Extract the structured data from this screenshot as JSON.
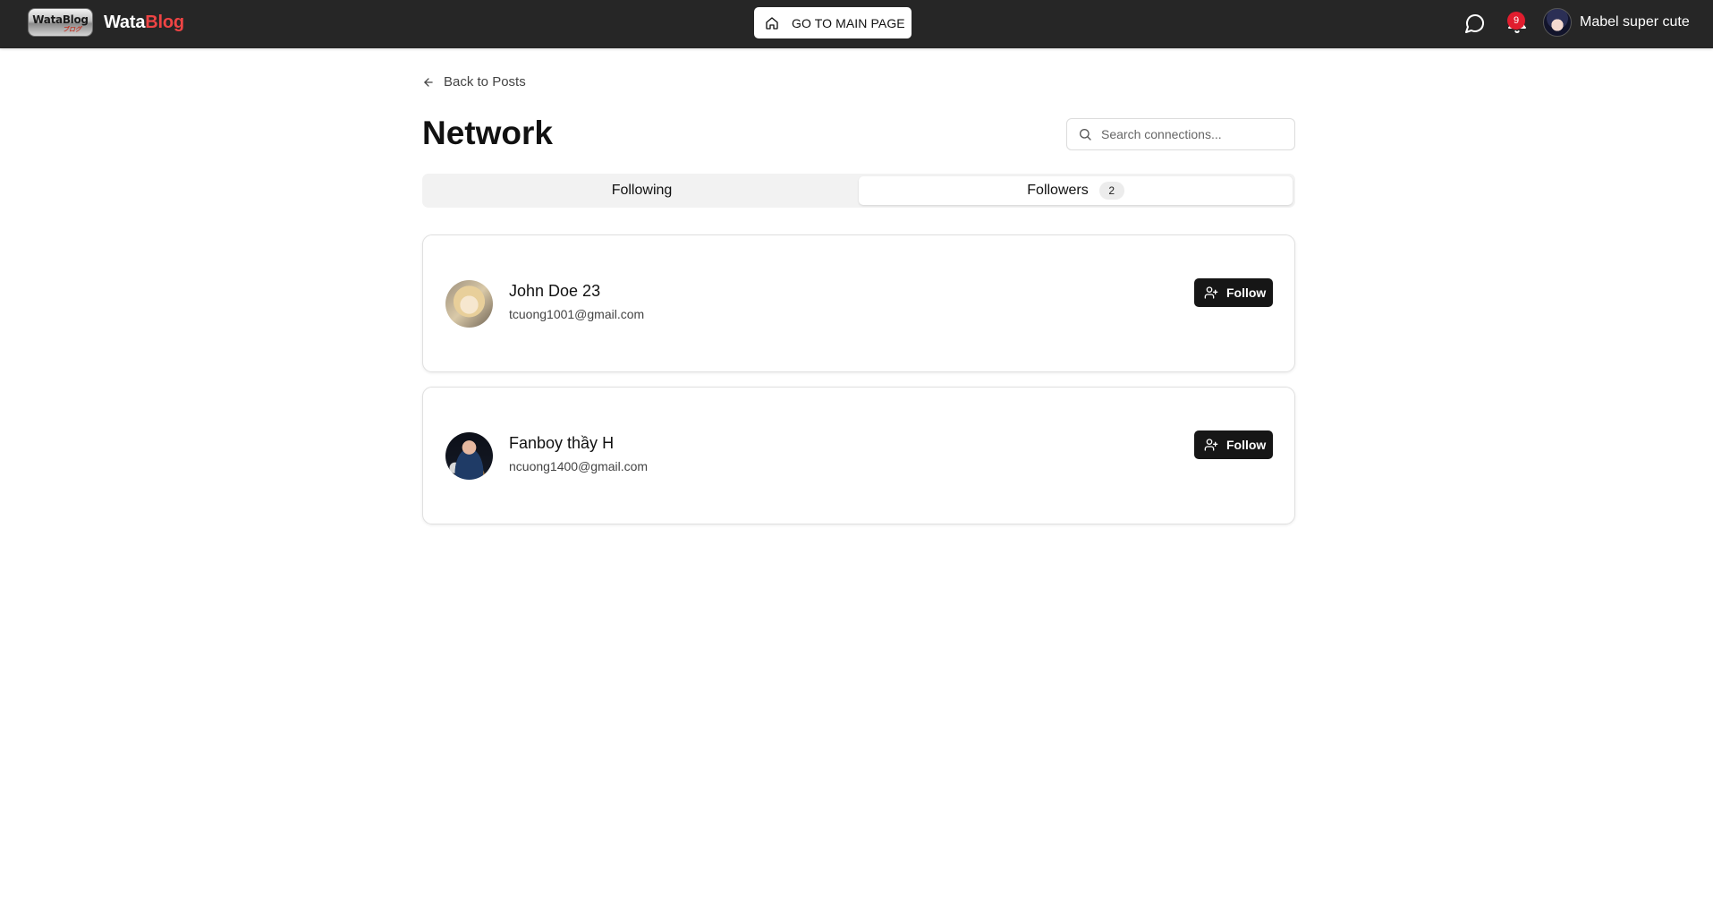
{
  "header": {
    "logo_text": "WataBlog",
    "logo_sub": "ブログ",
    "brand_part1": "Wata",
    "brand_part2": "Blog",
    "main_page_button": "GO TO MAIN PAGE",
    "notification_count": "9",
    "user_name": "Mabel super cute"
  },
  "page": {
    "back_link": "Back to Posts",
    "title": "Network",
    "search_placeholder": "Search connections..."
  },
  "tabs": [
    {
      "label": "Following",
      "active": false
    },
    {
      "label": "Followers",
      "count": "2",
      "active": true
    }
  ],
  "connections": [
    {
      "name": "John Doe 23",
      "email": "tcuong1001@gmail.com",
      "button": "Follow"
    },
    {
      "name": "Fanboy thầy H",
      "email": "ncuong1400@gmail.com",
      "button": "Follow"
    }
  ],
  "colors": {
    "topbar": "#262626",
    "brand_accent": "#ef4444",
    "badge": "#e11d2e",
    "follow_button": "#161616"
  }
}
